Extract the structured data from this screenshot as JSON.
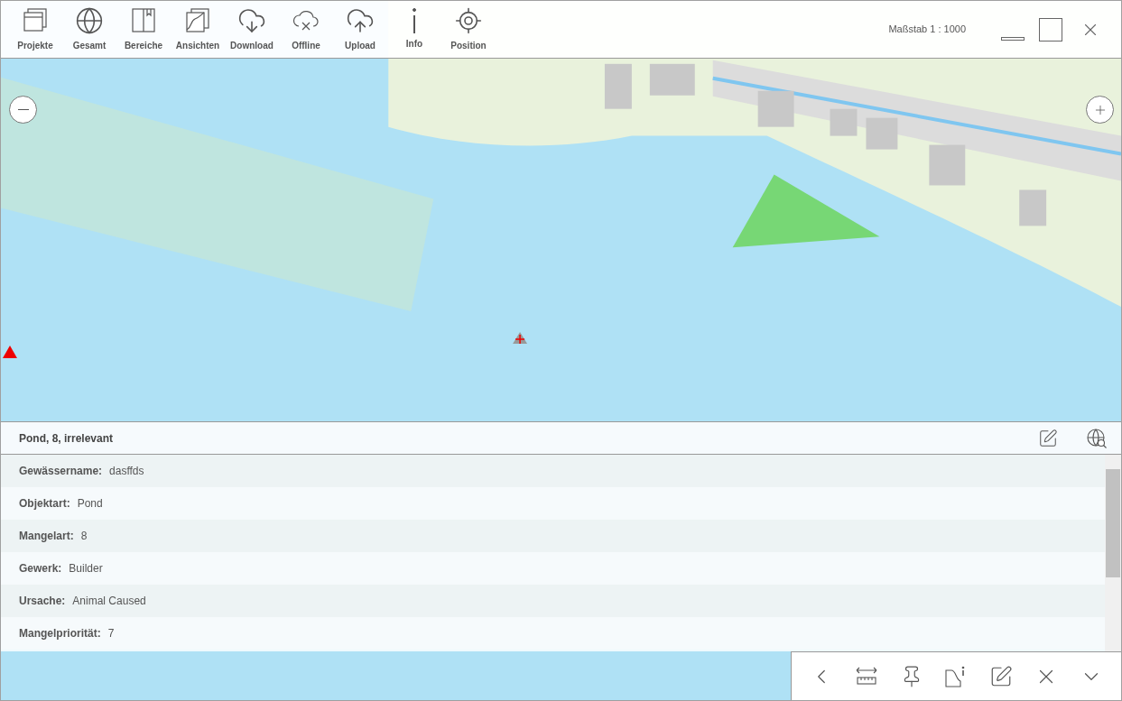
{
  "toolbar": {
    "items": [
      {
        "label": "Projekte"
      },
      {
        "label": "Gesamt"
      },
      {
        "label": "Bereiche"
      },
      {
        "label": "Ansichten"
      },
      {
        "label": "Download"
      },
      {
        "label": "Offline"
      },
      {
        "label": "Upload"
      },
      {
        "label": "Info"
      },
      {
        "label": "Position"
      }
    ],
    "scale": "Maßstab 1 : 1000"
  },
  "feature_panel": {
    "title": "Pond, 8, irrelevant",
    "attributes": [
      {
        "label": "Gewässername:",
        "value": "dasffds"
      },
      {
        "label": "Objektart:",
        "value": "Pond"
      },
      {
        "label": "Mangelart:",
        "value": "8"
      },
      {
        "label": "Gewerk:",
        "value": "Builder"
      },
      {
        "label": "Ursache:",
        "value": "Animal Caused"
      },
      {
        "label": "Mangelpriorität:",
        "value": "7"
      }
    ]
  }
}
